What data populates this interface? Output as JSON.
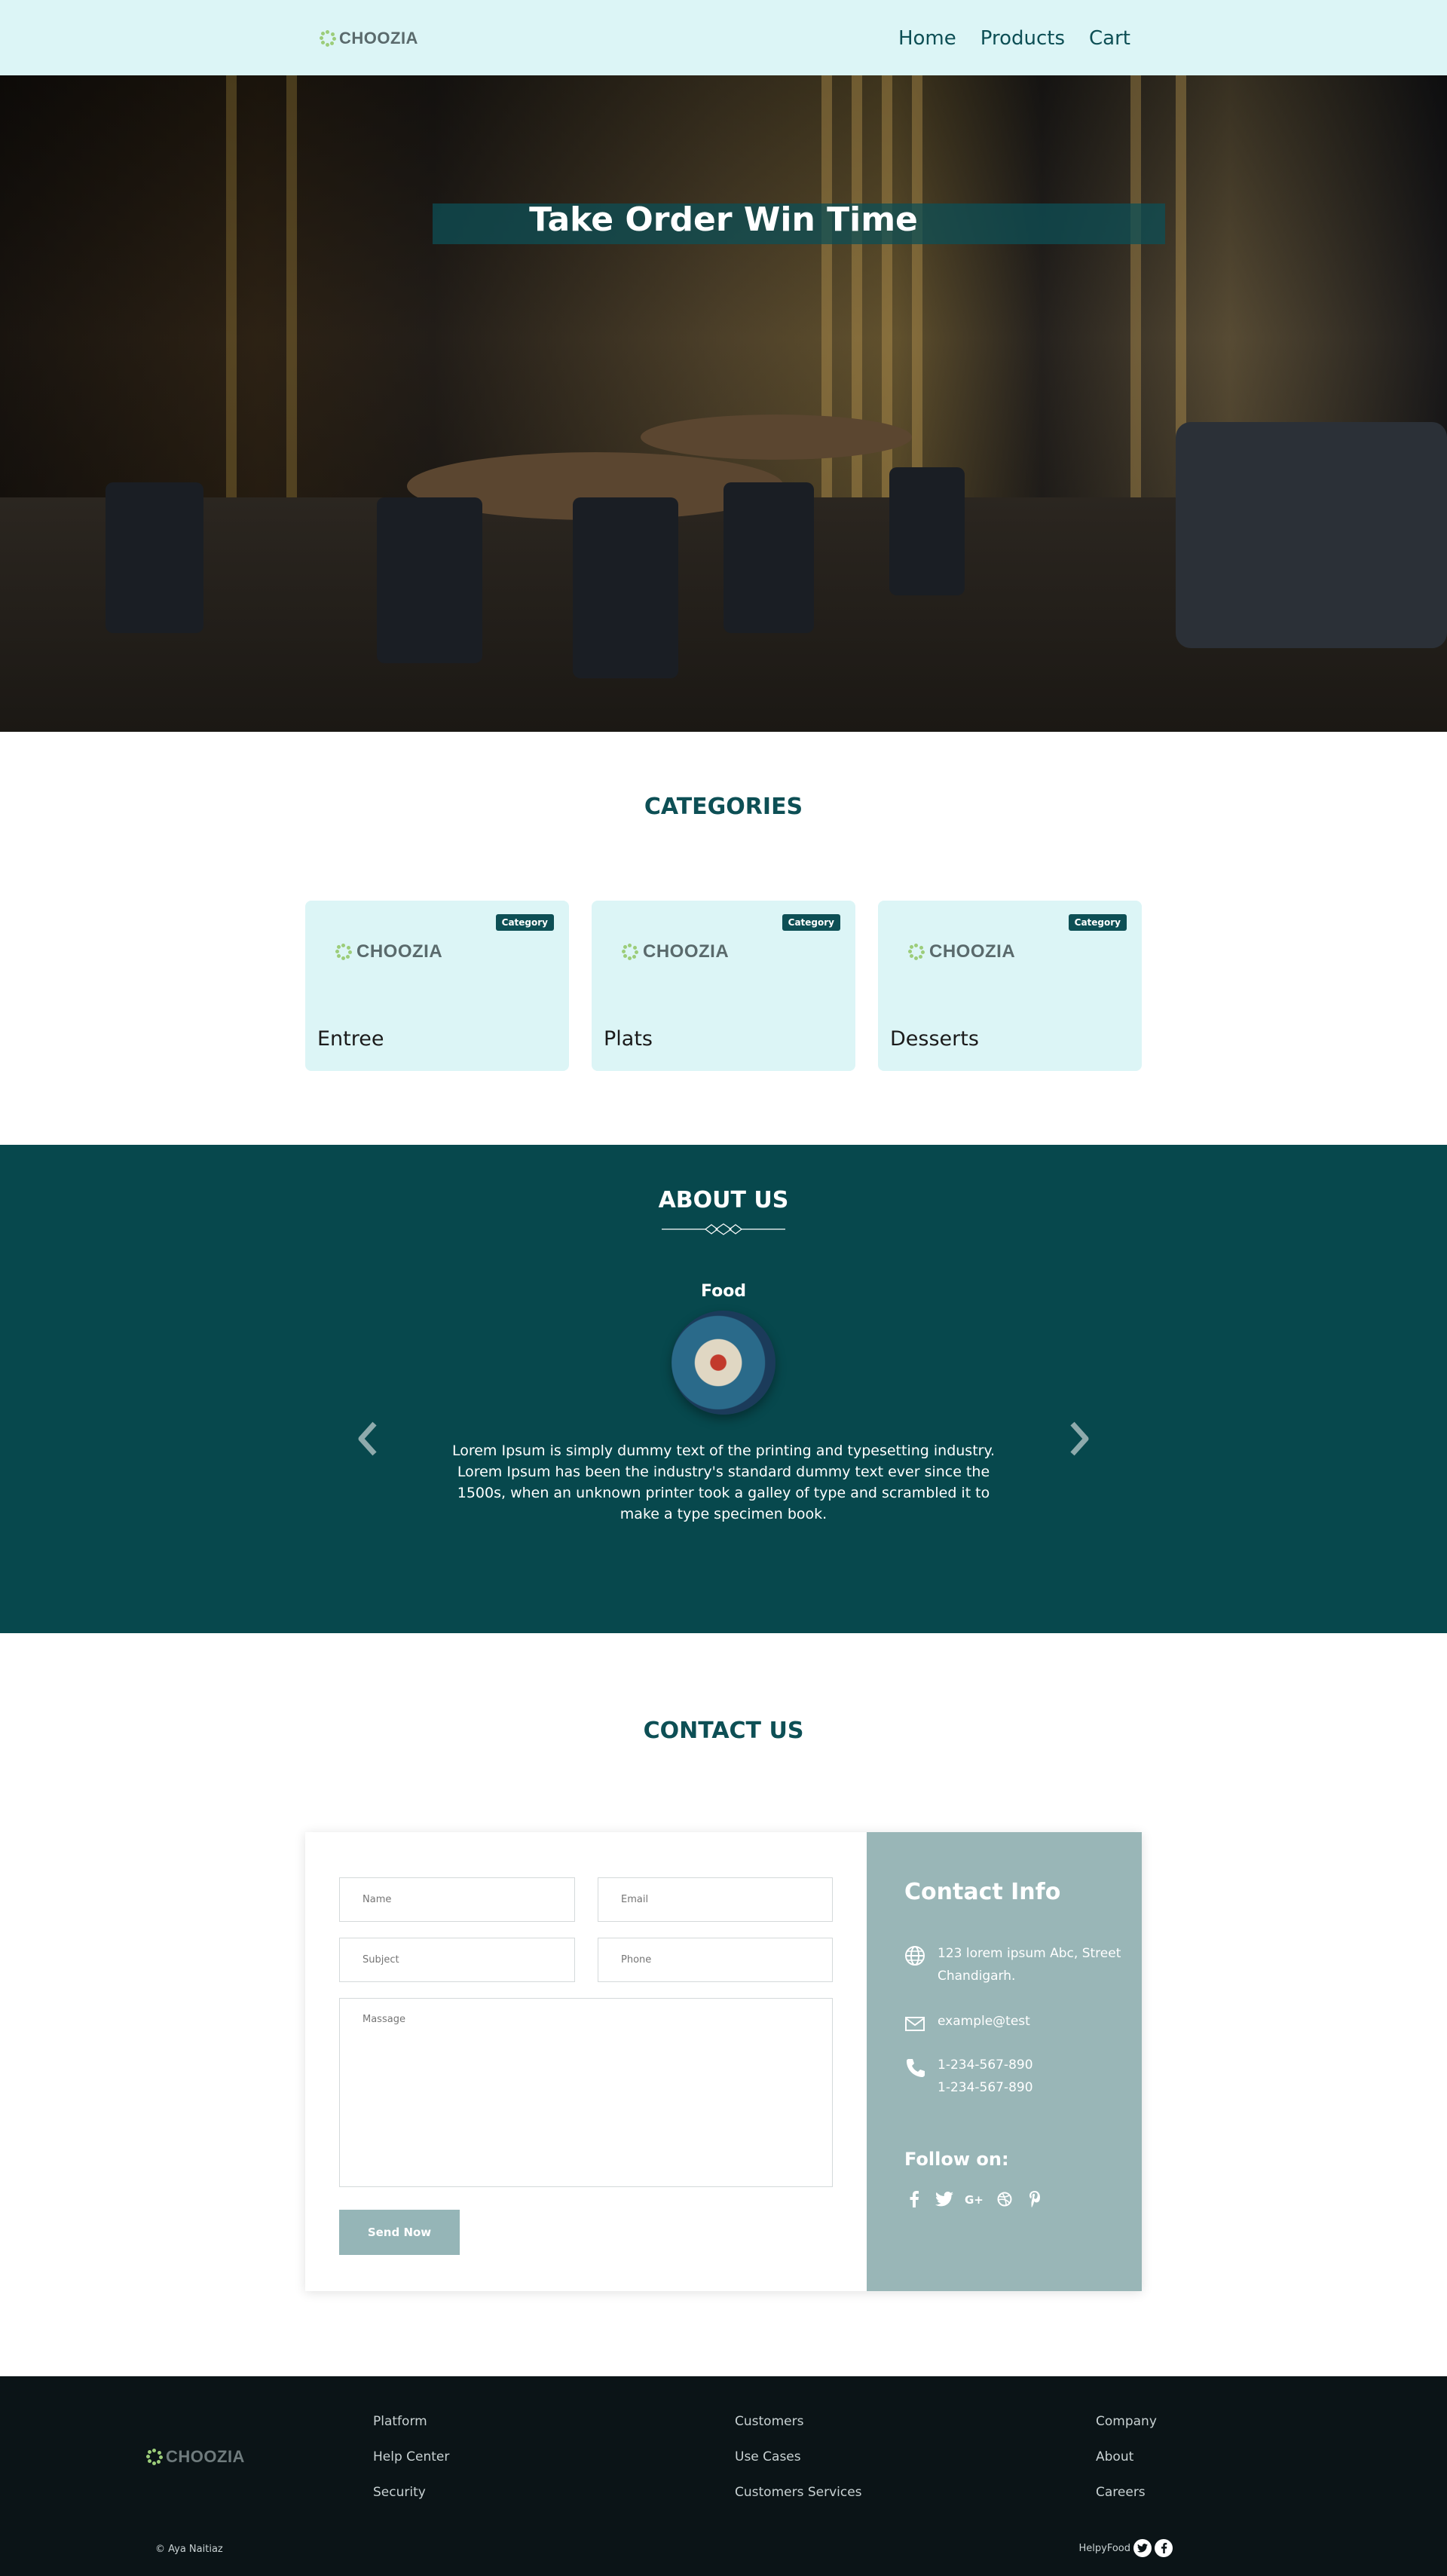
{
  "navbar": {
    "brand": "CHOOZIA",
    "links": [
      "Home",
      "Products",
      "Cart"
    ]
  },
  "hero": {
    "title": "Take Order Win Time"
  },
  "categories": {
    "title": "CATEGORIES",
    "badge": "Category",
    "logo": "CHOOZIA",
    "items": [
      {
        "name": "Entree"
      },
      {
        "name": "Plats"
      },
      {
        "name": "Desserts"
      }
    ]
  },
  "about": {
    "title": "ABOUT US",
    "slide_label": "Food",
    "text": "Lorem Ipsum is simply dummy text of the printing and typesetting industry. Lorem Ipsum has been the industry's standard dummy text ever since the 1500s, when an unknown printer took a galley of type and scrambled it to make a type specimen book."
  },
  "contact": {
    "title": "CONTACT US",
    "placeholders": {
      "name": "Name",
      "email": "Email",
      "subject": "Subject",
      "phone": "Phone",
      "message": "Massage"
    },
    "send_label": "Send Now",
    "info": {
      "title": "Contact Info",
      "address_line1": "123 lorem ipsum Abc, Street",
      "address_line2": "Chandigarh.",
      "email": "example@test",
      "phone1": "1-234-567-890",
      "phone2": "1-234-567-890",
      "follow_title": "Follow on:",
      "social_icons": [
        "facebook-icon",
        "twitter-icon",
        "google-plus-icon",
        "dribbble-icon",
        "pinterest-icon"
      ]
    }
  },
  "footer": {
    "brand": "CHOOZIA",
    "col1": [
      "Platform",
      "Help Center",
      "Security"
    ],
    "col2": [
      "Customers",
      "Use Cases",
      "Customers Services"
    ],
    "col3": [
      "Company",
      "About",
      "Careers"
    ],
    "copyright": "© Aya Naitiaz",
    "right_label": "HelpyFood"
  },
  "colors": {
    "primary": "#0d4f55",
    "light": "#dcf5f6",
    "about_bg": "#07484d",
    "info_bg": "#99b6b7",
    "footer_bg": "#0b1417",
    "accent_green": "#9ccd7a"
  }
}
